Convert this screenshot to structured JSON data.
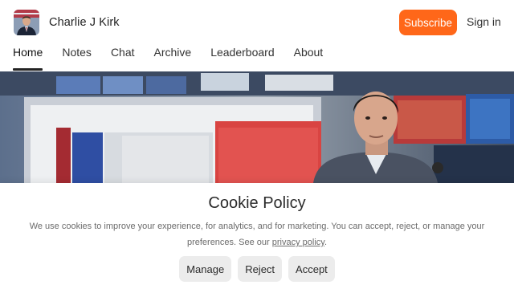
{
  "publication": {
    "name": "Charlie J Kirk",
    "avatar_icon": "profile-photo"
  },
  "header": {
    "subscribe_label": "Subscribe",
    "signin_label": "Sign in",
    "accent_color": "#ff6719"
  },
  "nav": {
    "items": [
      "Home",
      "Notes",
      "Chat",
      "Archive",
      "Leaderboard",
      "About"
    ],
    "active": "Home"
  },
  "cookie_banner": {
    "title": "Cookie Policy",
    "text": "We use cookies to improve your experience, for analytics, and for marketing. You can accept, reject, or manage your preferences. See our ",
    "link_text": "privacy policy",
    "text_end": ".",
    "buttons": {
      "manage": "Manage",
      "reject": "Reject",
      "accept": "Accept"
    }
  }
}
